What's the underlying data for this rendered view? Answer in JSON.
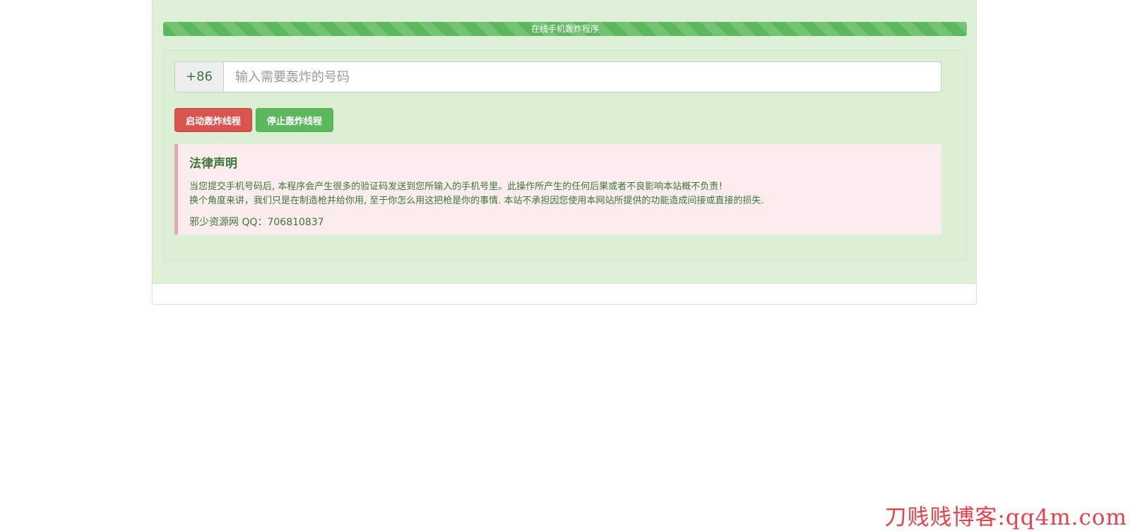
{
  "header": {
    "progress_label": "在线手机轰炸程序",
    "progress_fraction": 1.0
  },
  "form": {
    "country_code": "+86",
    "phone_placeholder": "输入需要轰炸的号码",
    "phone_value": ""
  },
  "buttons": {
    "start_label": "启动轰炸线程",
    "stop_label": "停止轰炸线程"
  },
  "legal": {
    "title": "法律声明",
    "line1": "当您提交手机号码后, 本程序会产生很多的验证码发送到您所输入的手机号里。此操作所产生的任何后果或者不良影响本站概不负责！",
    "line2": "换个角度来讲，我们只是在制造枪并给你用, 至于你怎么用这把枪是你的事情. 本站不承担因您使用本网站所提供的功能造成间接或直接的损失.",
    "contact": "邪少资源网 QQ：706810837"
  },
  "watermark": "刀贱贱博客:qq4m.com",
  "colors": {
    "panel_bg": "#dff0d8",
    "text_green": "#3c763d",
    "btn_danger": "#d9534f",
    "btn_success": "#5cb85c",
    "callout_bg": "#fbeded",
    "callout_border": "#e4a9ad",
    "watermark": "#e8404a"
  }
}
